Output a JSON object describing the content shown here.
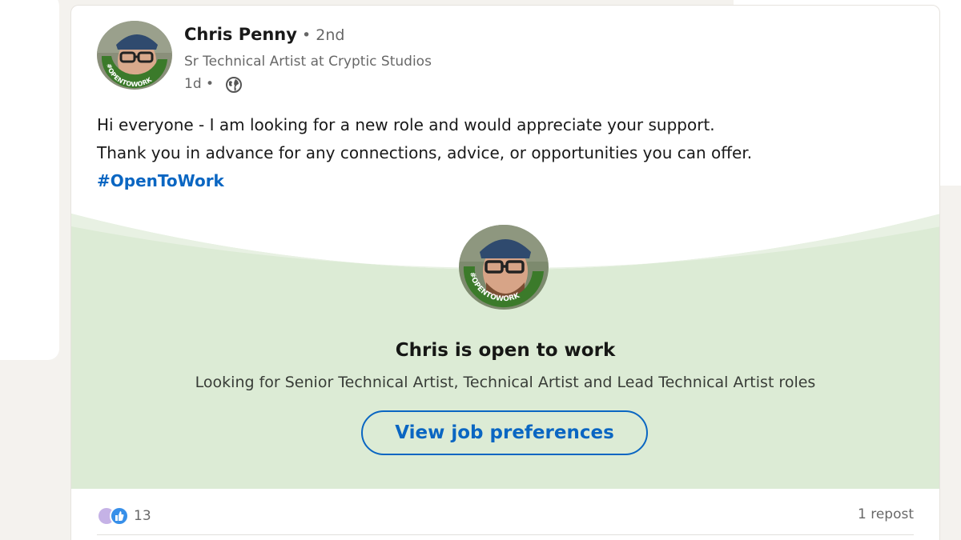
{
  "post": {
    "author": {
      "name": "Chris Penny",
      "degree": "• 2nd",
      "headline": "Sr Technical Artist at Cryptic Studios",
      "timestamp": "1d •",
      "visibility_icon": "globe-icon",
      "avatar_frame_text": "#OPENTOWORK"
    },
    "text": {
      "line1": "Hi everyone - I am looking for a new role and would appreciate your support.",
      "line2": "Thank you in advance for any connections, advice, or opportunities you can offer.",
      "hashtag": "#OpenToWork"
    },
    "open_to_work": {
      "frame_text": "#OPENTOWORK",
      "title": "Chris is open to work",
      "subtitle": "Looking for Senior Technical Artist, Technical Artist and Lead Technical Artist roles",
      "button_label": "View job preferences"
    },
    "social": {
      "reaction_icons": [
        "support-reaction-icon",
        "like-reaction-icon"
      ],
      "reaction_count": "13",
      "repost_count": "1 repost"
    }
  },
  "colors": {
    "link_blue": "#0a66c2",
    "otw_green": "#dcebd5",
    "otw_ring": "#3b7a2a",
    "page_bg": "#f4f2ee"
  }
}
